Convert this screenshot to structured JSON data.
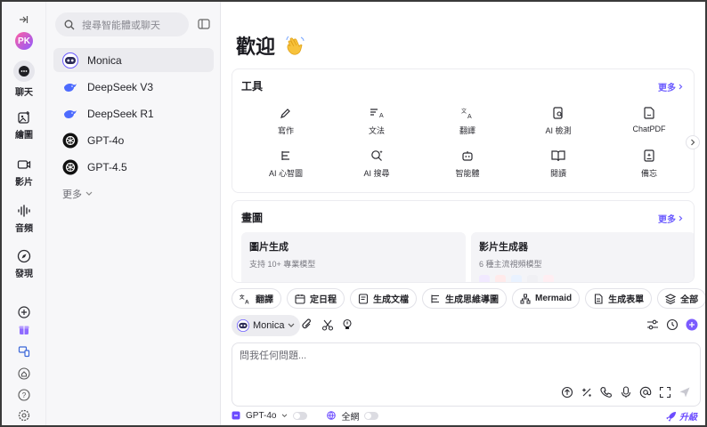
{
  "rail": {
    "items": [
      {
        "label": "聊天",
        "icon": "chat-icon"
      },
      {
        "label": "繪圖",
        "icon": "image-icon"
      },
      {
        "label": "影片",
        "icon": "video-icon"
      },
      {
        "label": "音頻",
        "icon": "audio-icon"
      },
      {
        "label": "發現",
        "icon": "compass-icon"
      }
    ],
    "logo": "PK"
  },
  "sidebar": {
    "search_placeholder": "搜尋智能體或聊天",
    "bots": [
      {
        "name": "Monica",
        "icon": "monica-icon"
      },
      {
        "name": "DeepSeek V3",
        "icon": "deepseek-icon"
      },
      {
        "name": "DeepSeek R1",
        "icon": "deepseek-icon"
      },
      {
        "name": "GPT-4o",
        "icon": "openai-icon"
      },
      {
        "name": "GPT-4.5",
        "icon": "openai-icon"
      }
    ],
    "more_label": "更多"
  },
  "main": {
    "welcome": "歡迎",
    "tools_card": {
      "title": "工具",
      "more": "更多",
      "tools": [
        {
          "label": "寫作",
          "icon": "pen-icon"
        },
        {
          "label": "文法",
          "icon": "grammar-icon"
        },
        {
          "label": "翻譯",
          "icon": "translate-icon"
        },
        {
          "label": "AI 檢測",
          "icon": "detect-icon"
        },
        {
          "label": "ChatPDF",
          "icon": "pdf-icon"
        },
        {
          "label": "AI 心智圖",
          "icon": "mindmap-icon"
        },
        {
          "label": "AI 搜尋",
          "icon": "search-ai-icon"
        },
        {
          "label": "智能體",
          "icon": "bot-icon"
        },
        {
          "label": "閱讀",
          "icon": "book-icon"
        },
        {
          "label": "備忘",
          "icon": "memo-icon"
        }
      ]
    },
    "draw_card": {
      "title": "畫圖",
      "more": "更多",
      "items": [
        {
          "title": "圖片生成",
          "desc": "支持 10+ 專業模型"
        },
        {
          "title": "影片生成器",
          "desc": "6 種主流視頻模型"
        }
      ]
    },
    "chips": [
      {
        "label": "翻譯",
        "icon": "translate-icon"
      },
      {
        "label": "定日程",
        "icon": "calendar-icon"
      },
      {
        "label": "生成文檔",
        "icon": "doc-icon"
      },
      {
        "label": "生成思維導圖",
        "icon": "mindmap-icon"
      },
      {
        "label": "Mermaid",
        "icon": "mermaid-icon"
      },
      {
        "label": "生成表單",
        "icon": "form-icon"
      },
      {
        "label": "全部",
        "icon": "layers-icon"
      }
    ],
    "model_selector": "Monica",
    "input_placeholder": "問我任何問題...",
    "bottom": {
      "model": "GPT-4o",
      "web": "全網",
      "upgrade": "升級"
    }
  },
  "colors": {
    "accent": "#6b5bff",
    "upgrade": "#6b4bff"
  }
}
